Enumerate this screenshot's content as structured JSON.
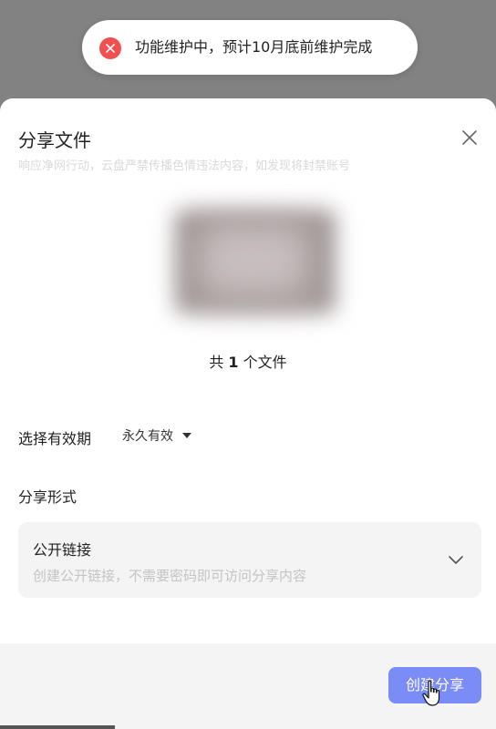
{
  "toast": {
    "icon": "error-circle-icon",
    "icon_color": "#f0504f",
    "message": "功能维护中，预计10月底前维护完成"
  },
  "dialog": {
    "title": "分享文件",
    "subtitle": "响应净网行动，云盘严禁传播色情违法内容，如发现将封禁账号",
    "file_count_prefix": "共",
    "file_count": "1",
    "file_count_suffix": "个文件",
    "validity": {
      "label": "选择有效期",
      "value": "永久有效"
    },
    "share_form": {
      "label": "分享形式",
      "option_title": "公开链接",
      "option_desc": "创建公开链接，不需要密码即可访问分享内容"
    },
    "create_button": "创建分享",
    "accent_color": "#7b8cf7"
  }
}
